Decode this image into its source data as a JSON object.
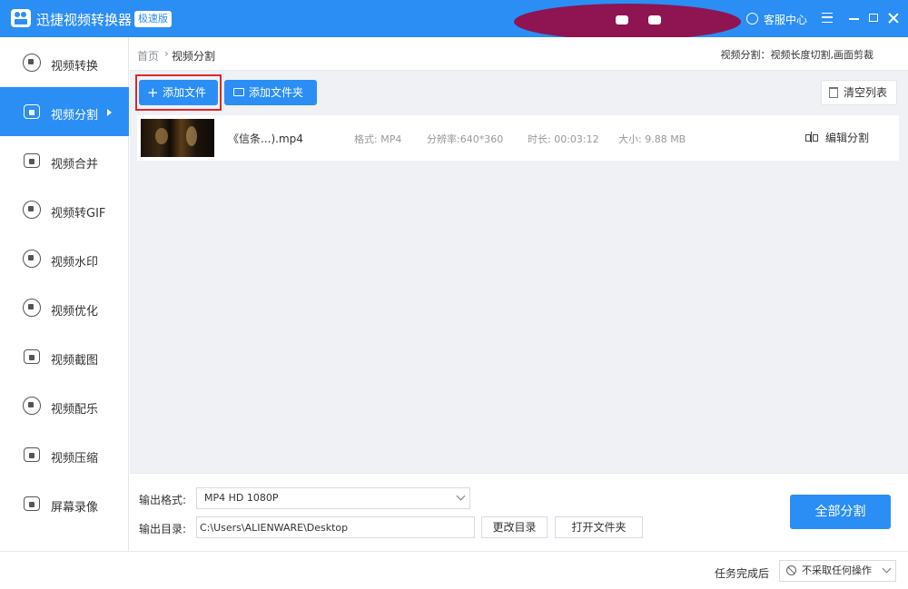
{
  "app": {
    "title": "迅捷视频转换器",
    "edition_badge": "极速版",
    "help_label": "客服中心",
    "accent_color": "#2b8ef5",
    "icons": [
      "app-logo-icon",
      "help-icon",
      "menu-icon",
      "minimize-icon",
      "maximize-icon",
      "close-icon"
    ]
  },
  "sidebar": {
    "items": [
      {
        "label": "视频转换",
        "icon": "convert-icon"
      },
      {
        "label": "视频分割",
        "icon": "split-icon",
        "active": true
      },
      {
        "label": "视频合并",
        "icon": "merge-icon"
      },
      {
        "label": "视频转GIF",
        "icon": "gif-icon"
      },
      {
        "label": "视频水印",
        "icon": "watermark-icon"
      },
      {
        "label": "视频优化",
        "icon": "optimize-icon"
      },
      {
        "label": "视频截图",
        "icon": "screenshot-icon"
      },
      {
        "label": "视频配乐",
        "icon": "music-icon"
      },
      {
        "label": "视频压缩",
        "icon": "compress-icon"
      },
      {
        "label": "屏幕录像",
        "icon": "record-icon"
      }
    ]
  },
  "breadcrumb": {
    "home": "首页",
    "separator": "›",
    "current": "视频分割",
    "description": "视频分割：视频长度切割,画面剪裁"
  },
  "toolbar": {
    "add_file": "添加文件",
    "add_folder": "添加文件夹",
    "clear_list": "清空列表"
  },
  "files": [
    {
      "name": "《信条...).mp4",
      "format": "格式: MP4",
      "resolution": "分辨率:640*360",
      "duration": "时长: 00:03:12",
      "size": "大小: 9.88 MB",
      "action": "编辑分割"
    }
  ],
  "output": {
    "format_label": "输出格式:",
    "format_value": "MP4   HD 1080P",
    "dir_label": "输出目录:",
    "dir_value": "C:\\Users\\ALIENWARE\\Desktop",
    "change_dir": "更改目录",
    "open_folder": "打开文件夹",
    "split_all": "全部分割"
  },
  "status": {
    "after_label": "任务完成后",
    "after_value": "不采取任何操作"
  }
}
